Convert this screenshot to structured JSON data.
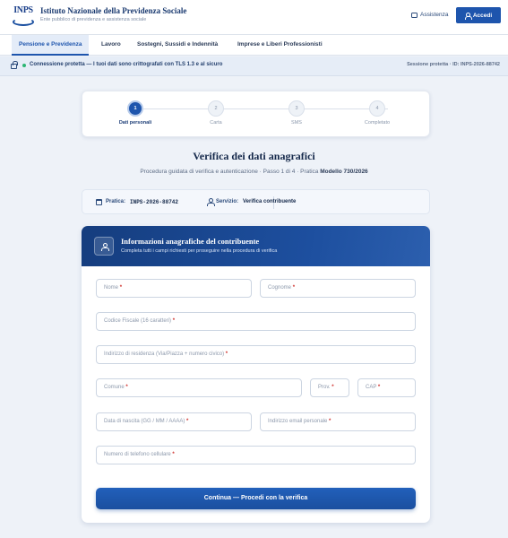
{
  "header": {
    "logo_text": "INPS",
    "title": "Istituto Nazionale della Previdenza Sociale",
    "subtitle": "Ente pubblico di previdenza e assistenza sociale",
    "assist_label": "Assistenza",
    "login_label": "Accedi"
  },
  "nav": {
    "tabs": [
      {
        "label": "Pensione e Previdenza",
        "active": true
      },
      {
        "label": "Lavoro"
      },
      {
        "label": "Sostegni, Sussidi e Indennità"
      },
      {
        "label": "Imprese e Liberi Professionisti"
      }
    ]
  },
  "security": {
    "text": "Connessione protetta — I tuoi dati sono crittografati con TLS 1.3 e al sicuro",
    "session": "Sessione protetta · ID: INPS-2026-88742"
  },
  "stepper": {
    "steps": [
      {
        "number": "1",
        "label": "Dati personali",
        "active": true
      },
      {
        "number": "2",
        "label": "Carta"
      },
      {
        "number": "3",
        "label": "SMS"
      },
      {
        "number": "4",
        "label": "Completato"
      }
    ]
  },
  "page": {
    "title": "Verifica dei dati anagrafici",
    "subtitle_prefix": "Procedura guidata di verifica e autenticazione · Passo 1 di 4 · Pratica ",
    "subtitle_bold": "Modello 730/2026"
  },
  "info": {
    "practice_label": "Pratica:",
    "practice_value": "INPS-2026-88742",
    "service_label": "Servizio:",
    "service_value": "Verifica contribuente"
  },
  "form": {
    "title": "Informazioni anagrafiche del contribuente",
    "subtitle": "Completa tutti i campi richiesti per proseguire nella procedura di verifica",
    "fields": {
      "nome": "Nome",
      "cognome": "Cognome",
      "codice_fiscale": "Codice Fiscale (16 caratteri)",
      "indirizzo": "Indirizzo di residenza (Via/Piazza + numero civico)",
      "comune": "Comune",
      "prov": "Prov.",
      "cap": "CAP",
      "data_nascita": "Data di nascita (GG / MM / AAAA)",
      "email": "Indirizzo email personale",
      "telefono": "Numero di telefono cellulare"
    },
    "required_mark": "*",
    "submit_label": "Continua — Procedi con la verifica"
  },
  "colors": {
    "primary": "#1e55ad",
    "header_dark": "#153d7e",
    "secure_green": "#2bb673",
    "required_red": "#d0312d"
  }
}
